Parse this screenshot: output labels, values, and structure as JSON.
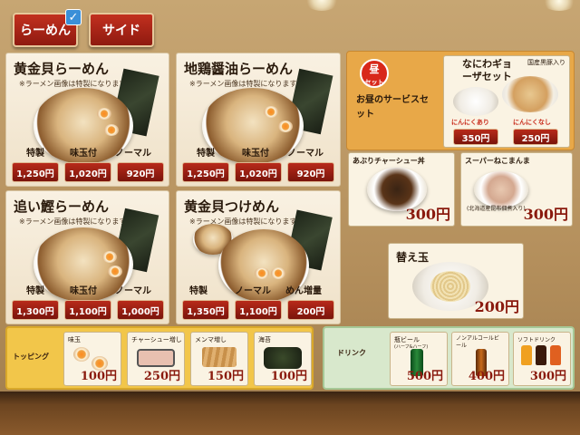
{
  "tabs": [
    {
      "label": "らーめん",
      "selected": true
    },
    {
      "label": "サイド",
      "selected": false
    }
  ],
  "menu": [
    {
      "name": "黄金貝らーめん",
      "note": "※ラーメン画像は特製になります。",
      "options": [
        "特製",
        "味玉付",
        "ノーマル"
      ],
      "prices": [
        "1,250円",
        "1,020円",
        "920円"
      ]
    },
    {
      "name": "地鶏醤油らーめん",
      "note": "※ラーメン画像は特製になります。",
      "options": [
        "特製",
        "味玉付",
        "ノーマル"
      ],
      "prices": [
        "1,250円",
        "1,020円",
        "920円"
      ]
    },
    {
      "name": "追い鰹らーめん",
      "note": "※ラーメン画像は特製になります。",
      "options": [
        "特製",
        "味玉付",
        "ノーマル"
      ],
      "prices": [
        "1,300円",
        "1,100円",
        "1,000円"
      ]
    },
    {
      "name": "黄金貝つけめん",
      "note": "※ラーメン画像は特製になります。",
      "options": [
        "特製",
        "ノーマル",
        "めん増量"
      ],
      "prices": [
        "1,350円",
        "1,100円",
        "200円"
      ]
    }
  ],
  "lunch": {
    "badge_top": "昼",
    "badge_bottom": "セット",
    "text": "お昼のサービスセット"
  },
  "gyoza": {
    "title": "なにわギョーザセット",
    "badge": "国産黒豚入り",
    "options": [
      "にんにくあり",
      "にんにくなし"
    ],
    "prices": [
      "350円",
      "250円"
    ]
  },
  "sides": [
    {
      "name": "あぶりチャーシュー丼",
      "price": "300円"
    },
    {
      "name": "スーパーねこまんま",
      "sub": "(北海道産昆布佃煮入り)",
      "price": "300円"
    }
  ],
  "kaedama": {
    "name": "替え玉",
    "price": "200円"
  },
  "toppings": {
    "label": "トッピング",
    "items": [
      {
        "name": "味玉",
        "price": "100円"
      },
      {
        "name": "チャーシュー増し",
        "price": "250円"
      },
      {
        "name": "メンマ増し",
        "price": "150円"
      },
      {
        "name": "海苔",
        "price": "100円"
      }
    ]
  },
  "drinks": {
    "label": "ドリンク",
    "items": [
      {
        "name": "瓶ビール",
        "sub": "(ハーフ&ハーフ)",
        "price": "500円"
      },
      {
        "name": "ノンアルコールビール",
        "price": "400円"
      },
      {
        "name": "ソフトドリンク",
        "price": "300円"
      }
    ]
  },
  "colors": {
    "accent": "#b82a1a",
    "panel_yellow": "#f2c64a",
    "panel_green": "#d8e8cc"
  }
}
